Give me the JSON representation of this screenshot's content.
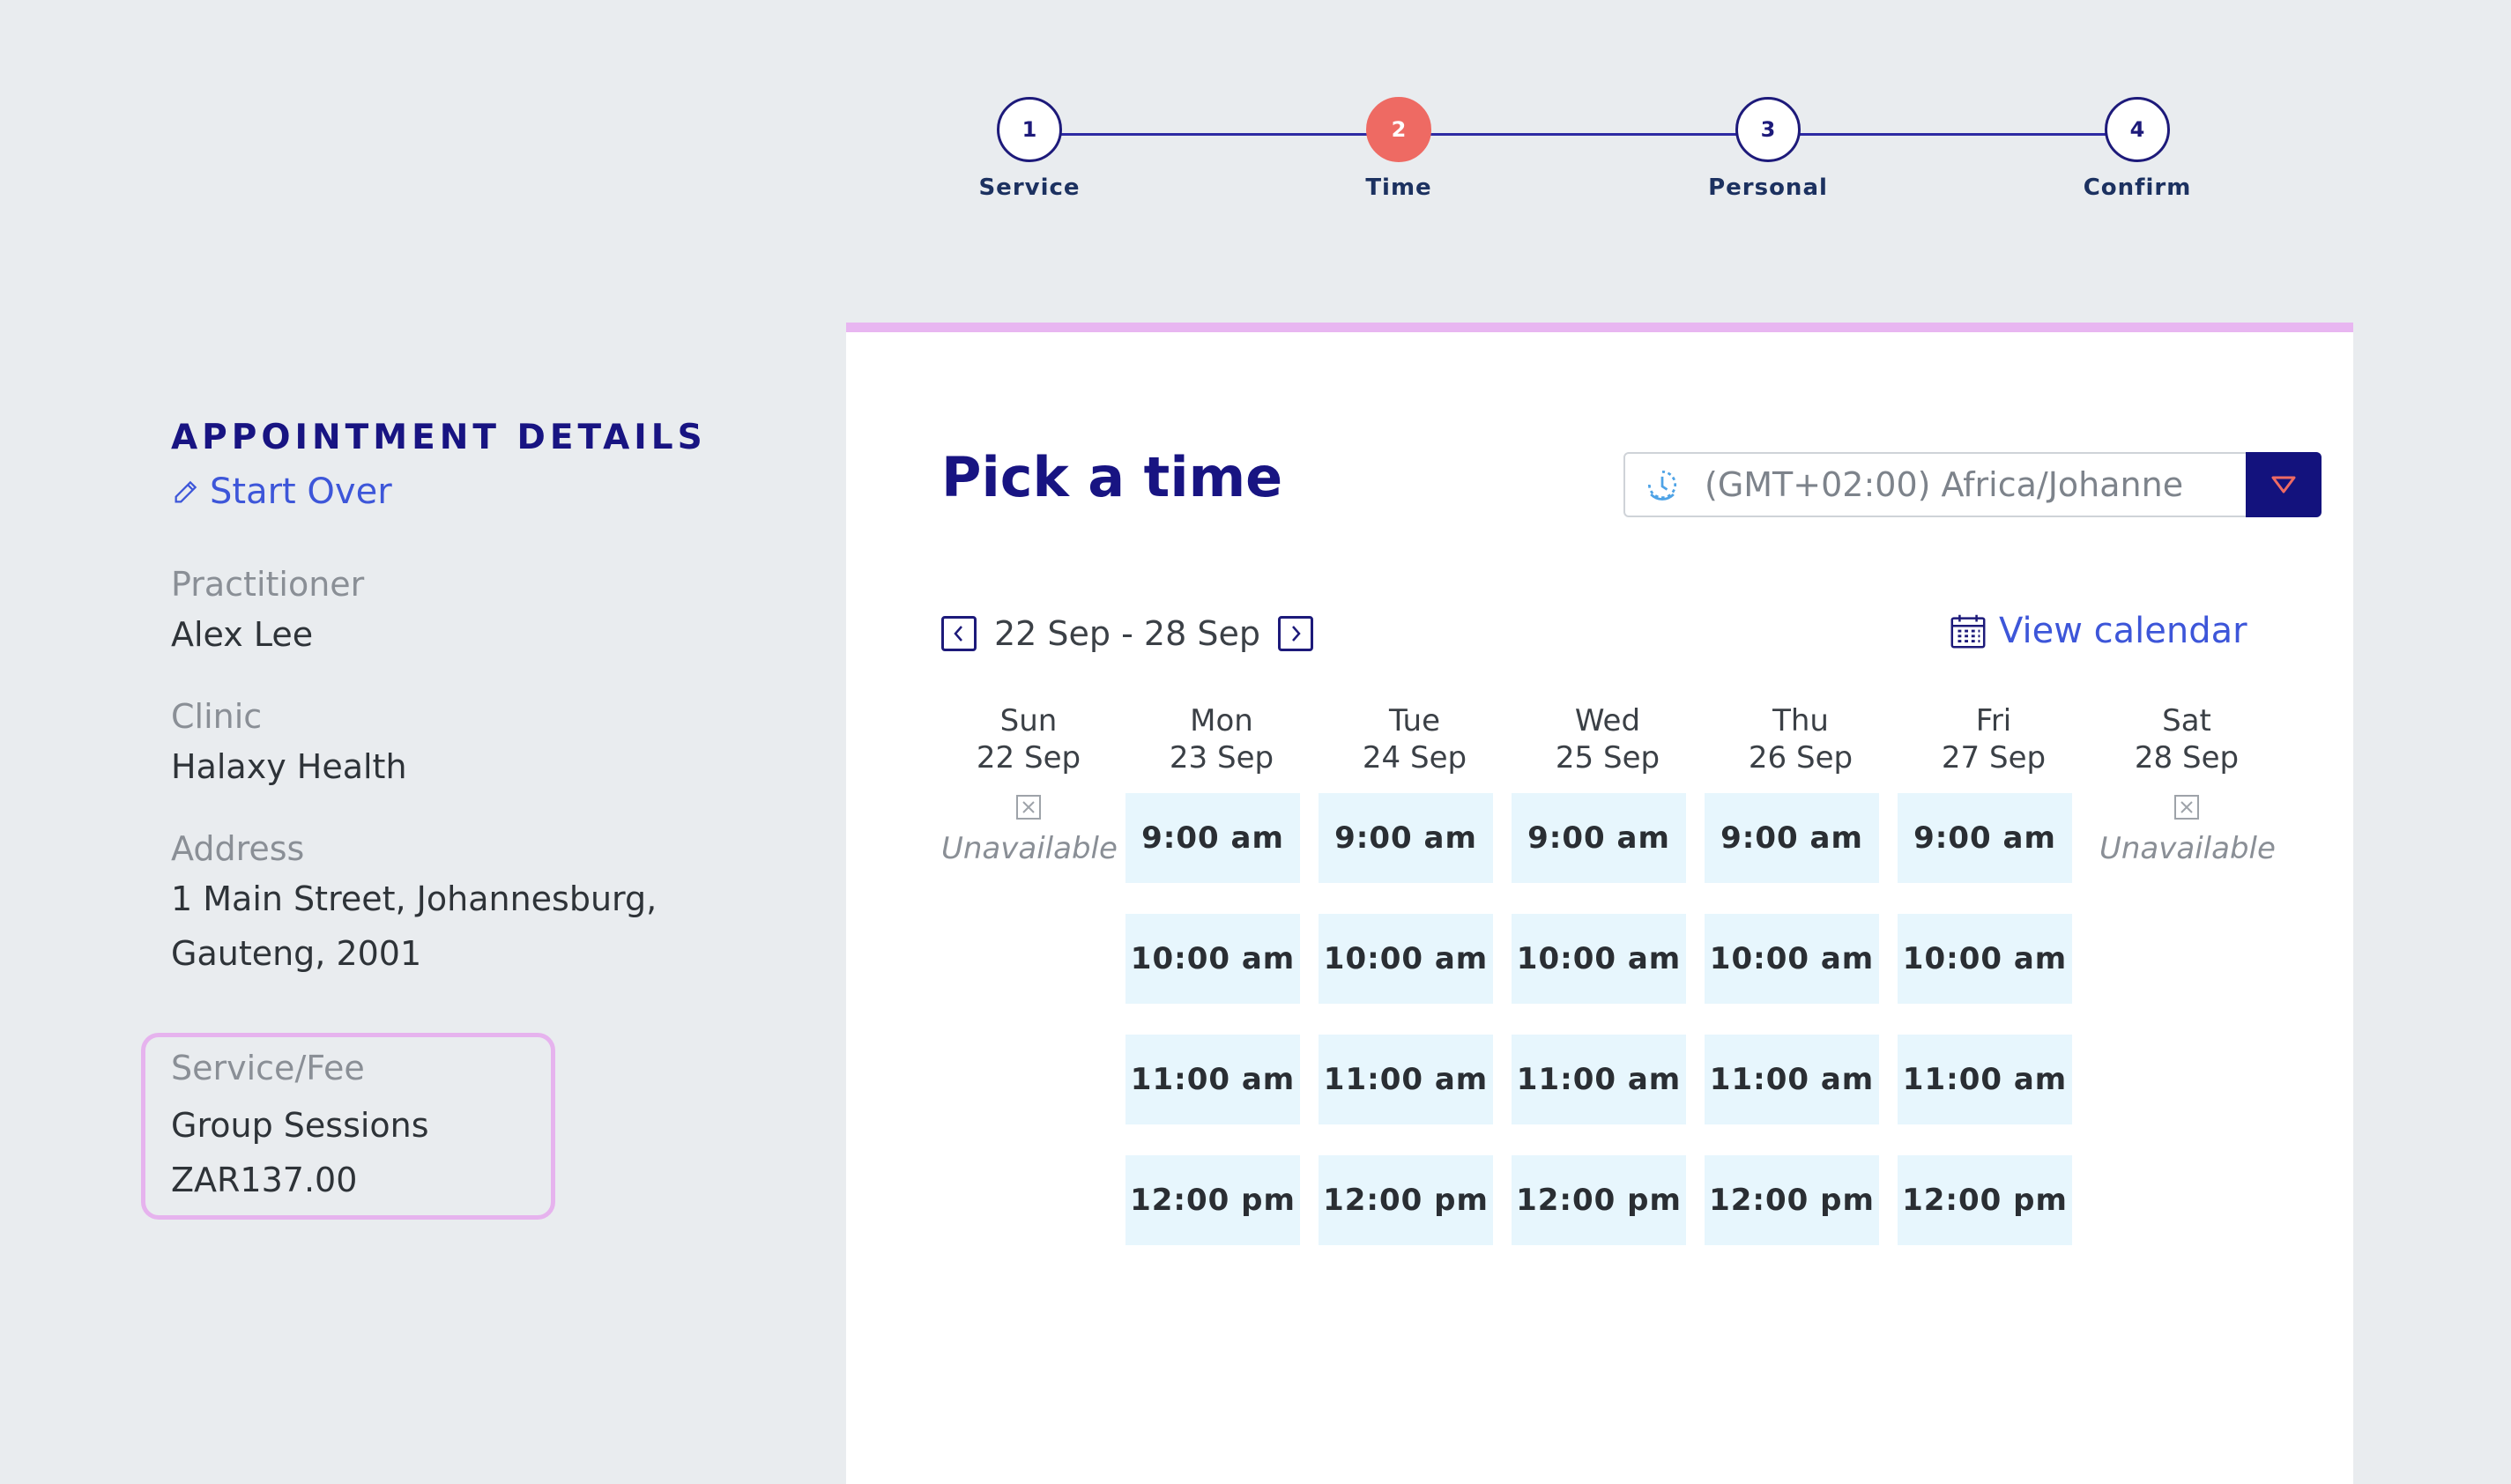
{
  "stepper": {
    "steps": [
      {
        "num": "1",
        "label": "Service"
      },
      {
        "num": "2",
        "label": "Time"
      },
      {
        "num": "3",
        "label": "Personal"
      },
      {
        "num": "4",
        "label": "Confirm"
      }
    ],
    "active_step": 2
  },
  "details": {
    "title": "APPOINTMENT DETAILS",
    "start_over": "Start Over",
    "practitioner_label": "Practitioner",
    "practitioner_value": "Alex Lee",
    "clinic_label": "Clinic",
    "clinic_value": "Halaxy Health",
    "address_label": "Address",
    "address_value": "1 Main Street, Johannesburg, Gauteng, 2001",
    "service_label": "Service/Fee",
    "service_value": "Group Sessions",
    "fee_value": "ZAR137.00"
  },
  "picker": {
    "title": "Pick a time",
    "timezone_value": "(GMT+02:00) Africa/Johanne",
    "week_range": "22 Sep - 28 Sep",
    "view_calendar": "View calendar",
    "unavailable_label": "Unavailable",
    "days": [
      {
        "name": "Sun",
        "date": "22 Sep",
        "slots": []
      },
      {
        "name": "Mon",
        "date": "23 Sep",
        "slots": [
          "9:00 am",
          "10:00 am",
          "11:00 am",
          "12:00 pm"
        ]
      },
      {
        "name": "Tue",
        "date": "24 Sep",
        "slots": [
          "9:00 am",
          "10:00 am",
          "11:00 am",
          "12:00 pm"
        ]
      },
      {
        "name": "Wed",
        "date": "25 Sep",
        "slots": [
          "9:00 am",
          "10:00 am",
          "11:00 am",
          "12:00 pm"
        ]
      },
      {
        "name": "Thu",
        "date": "26 Sep",
        "slots": [
          "9:00 am",
          "10:00 am",
          "11:00 am",
          "12:00 pm"
        ]
      },
      {
        "name": "Fri",
        "date": "27 Sep",
        "slots": [
          "9:00 am",
          "10:00 am",
          "11:00 am",
          "12:00 pm"
        ]
      },
      {
        "name": "Sat",
        "date": "28 Sep",
        "slots": []
      }
    ]
  },
  "colors": {
    "brand_navy": "#181482",
    "active_step": "#ee6a63",
    "link_blue": "#3d56d9",
    "slot_bg": "#e7f6fd",
    "panel_accent": "#e8b6f1"
  }
}
